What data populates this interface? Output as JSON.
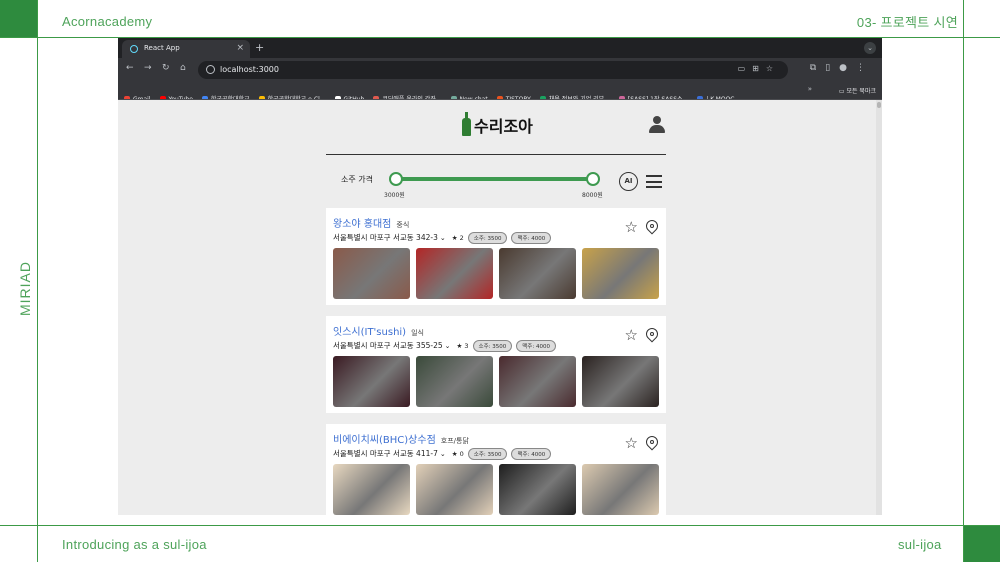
{
  "slide": {
    "brand": "Acornacademy",
    "section_title": "03- 프로젝트 시연",
    "side_label": "MIRIAD",
    "footer_left": "Introducing as a sul-ijoa",
    "footer_right": "sul-ijoa",
    "accent_color": "#2e8b3e"
  },
  "browser": {
    "tab_title": "React App",
    "url": "localhost:3000",
    "bookmarks": [
      {
        "label": "Gmail",
        "color": "#ea4335"
      },
      {
        "label": "YouTube",
        "color": "#ff0000"
      },
      {
        "label": "한국공학대학교",
        "color": "#4285f4"
      },
      {
        "label": "한국공학대학교 e-Cl...",
        "color": "#fbbc05"
      },
      {
        "label": "GitHub",
        "color": "#ffffff"
      },
      {
        "label": "코딩애플 온라인 강좌...",
        "color": "#e05a4f"
      },
      {
        "label": "New chat",
        "color": "#74aa9c"
      },
      {
        "label": "TISTORY",
        "color": "#eb531f"
      },
      {
        "label": "채용 정보와 기업 리뷰...",
        "color": "#1aa260"
      },
      {
        "label": "[SASS] 1장 SASS소...",
        "color": "#cc6699"
      },
      {
        "label": "| K-MOOC",
        "color": "#3b6fd8"
      }
    ],
    "more_bookmarks": "»",
    "all_bookmarks": "모든 북마크"
  },
  "app": {
    "logo_text": "수리조아",
    "price_label": "소주 가격",
    "price_min": "3000원",
    "price_max": "8000원",
    "price_range_fraction": [
      0.0,
      1.0
    ],
    "ai_label": "AI",
    "restaurants": [
      {
        "name": "왕소야 홍대점",
        "category": "중식",
        "address": "서울특별시 마포구 서교동 342-3",
        "rating": "★ 2",
        "soju": "소주: 3500",
        "beer": "맥주: 4000",
        "photos": [
          "#8a5a4a",
          "#b32626",
          "#4a3a30",
          "#c8a24a"
        ]
      },
      {
        "name": "잇스시(IT'sushi)",
        "category": "일식",
        "address": "서울특별시 마포구 서교동 355-25",
        "rating": "★ 3",
        "soju": "소주: 3500",
        "beer": "맥주: 4000",
        "photos": [
          "#3a1a22",
          "#3a4a3a",
          "#4a2a2e",
          "#2a2220"
        ]
      },
      {
        "name": "비에이치씨(BHC)상수점",
        "category": "호프/통닭",
        "address": "서울특별시 마포구 서교동 411-7",
        "rating": "★ 0",
        "soju": "소주: 3500",
        "beer": "맥주: 4000",
        "photos": [
          "#e8d8c0",
          "#e2d0b8",
          "#1e1e1e",
          "#dccab0"
        ]
      }
    ]
  }
}
